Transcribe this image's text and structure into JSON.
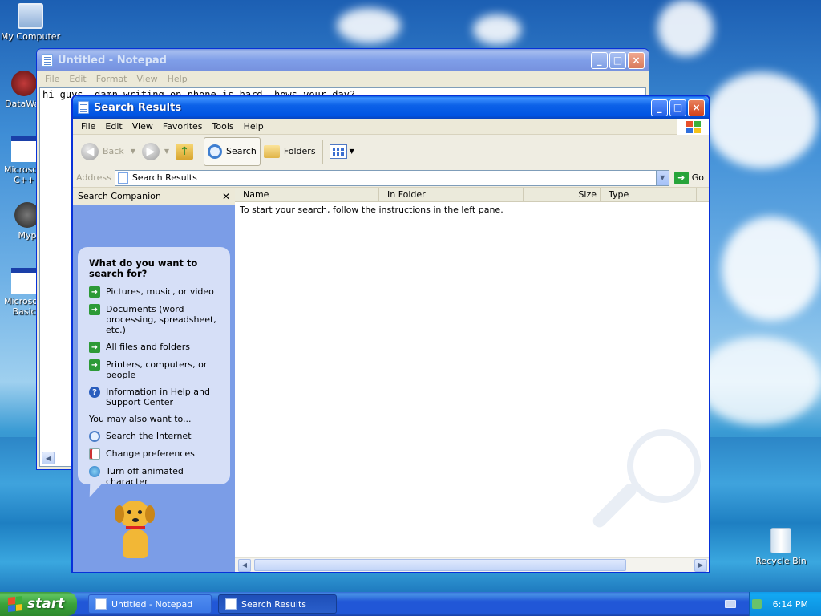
{
  "desktop": {
    "icons": [
      {
        "label": "My Computer"
      },
      {
        "label": "DataWar"
      },
      {
        "label": "Microsoft C++"
      },
      {
        "label": "Myp"
      },
      {
        "label": "Microsoft Basic"
      },
      {
        "label": "Recycle Bin"
      }
    ]
  },
  "notepad": {
    "title": "Untitled - Notepad",
    "menu": [
      "File",
      "Edit",
      "Format",
      "View",
      "Help"
    ],
    "text": "hi guys, damn writing on phone is hard. hows your day?"
  },
  "search": {
    "title": "Search Results",
    "menu": [
      "File",
      "Edit",
      "View",
      "Favorites",
      "Tools",
      "Help"
    ],
    "toolbar": {
      "back": "Back",
      "search": "Search",
      "folders": "Folders"
    },
    "address": {
      "label": "Address",
      "value": "Search Results",
      "go": "Go"
    },
    "companion": {
      "header": "Search Companion",
      "question": "What do you want to search for?",
      "options": [
        "Pictures, music, or video",
        "Documents (word processing, spreadsheet, etc.)",
        "All files and folders",
        "Printers, computers, or people",
        "Information in Help and Support Center"
      ],
      "also_label": "You may also want to...",
      "also": [
        "Search the Internet",
        "Change preferences",
        "Turn off animated character"
      ]
    },
    "columns": [
      "Name",
      "In Folder",
      "Size",
      "Type"
    ],
    "empty_message": "To start your search, follow the instructions in the left pane."
  },
  "taskbar": {
    "start": "start",
    "tasks": [
      "Untitled - Notepad",
      "Search Results"
    ],
    "clock": "6:14 PM"
  },
  "colors": {
    "xp_blue": "#0054e3",
    "companion_pane": "#7b9de7",
    "balloon": "#d6dff7",
    "start_green": "#3aa33a",
    "action_green": "#2d9a37"
  }
}
